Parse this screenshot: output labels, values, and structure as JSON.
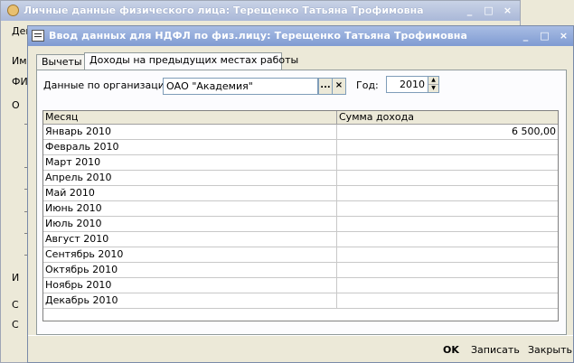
{
  "background_window": {
    "title": "Личные данные физического лица: Терещенко Татьяна Трофимовна",
    "left_labels": [
      "Дей",
      "Им",
      "ФИ",
      "О",
      "С",
      "И",
      "С"
    ]
  },
  "dialog": {
    "title": "Ввод данных для НДФЛ по физ.лицу: Терещенко Татьяна Трофимовна",
    "buttons": {
      "minimize": "_",
      "maximize": "□",
      "close": "×"
    }
  },
  "tabs": [
    {
      "label": "Вычеты",
      "active": false
    },
    {
      "label": "Доходы на предыдущих местах работы",
      "active": true
    }
  ],
  "form": {
    "org_label": "Данные по организации:",
    "org_value": "ОАО \"Академия\"",
    "org_select": "...",
    "org_clear": "×",
    "year_label": "Год:",
    "year_value": "2010"
  },
  "table": {
    "columns": [
      "Месяц",
      "Сумма дохода"
    ],
    "rows": [
      {
        "month": "Январь 2010",
        "amount": "6 500,00"
      },
      {
        "month": "Февраль 2010",
        "amount": ""
      },
      {
        "month": "Март 2010",
        "amount": ""
      },
      {
        "month": "Апрель 2010",
        "amount": ""
      },
      {
        "month": "Май 2010",
        "amount": ""
      },
      {
        "month": "Июнь 2010",
        "amount": ""
      },
      {
        "month": "Июль 2010",
        "amount": ""
      },
      {
        "month": "Август 2010",
        "amount": ""
      },
      {
        "month": "Сентябрь 2010",
        "amount": ""
      },
      {
        "month": "Октябрь 2010",
        "amount": ""
      },
      {
        "month": "Ноябрь 2010",
        "amount": ""
      },
      {
        "month": "Декабрь 2010",
        "amount": ""
      }
    ]
  },
  "footer": {
    "ok": "OK",
    "write": "Записать",
    "close": "Закрыть"
  }
}
